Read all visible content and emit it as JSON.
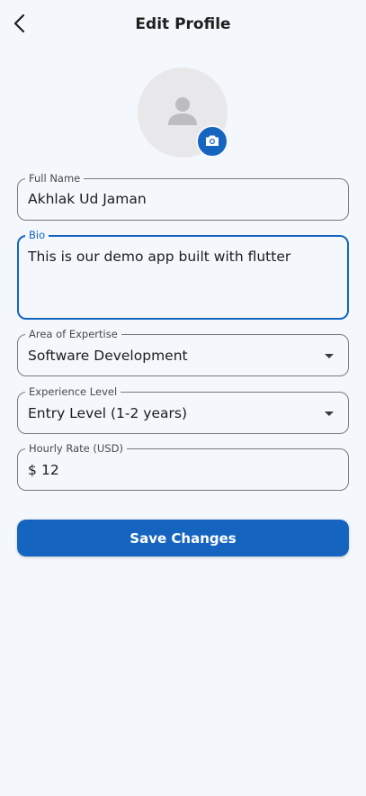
{
  "appbar": {
    "title": "Edit Profile",
    "back_icon": "arrow-back-icon"
  },
  "avatar": {
    "icon": "person-icon",
    "camera_icon": "camera-icon",
    "accent_color": "#1565c0"
  },
  "form": {
    "full_name": {
      "label": "Full Name",
      "value": "Akhlak Ud Jaman"
    },
    "bio": {
      "label": "Bio",
      "value": "This is our demo app built with flutter",
      "focused": true
    },
    "area_of_expertise": {
      "label": "Area of Expertise",
      "value": "Software Development"
    },
    "experience_level": {
      "label": "Experience Level",
      "value": "Entry Level (1-2 years)"
    },
    "hourly_rate": {
      "label": "Hourly Rate (USD)",
      "prefix": "$",
      "value": "12"
    }
  },
  "actions": {
    "save_label": "Save Changes"
  },
  "colors": {
    "primary": "#1565c0",
    "background": "#f4f7fb"
  }
}
